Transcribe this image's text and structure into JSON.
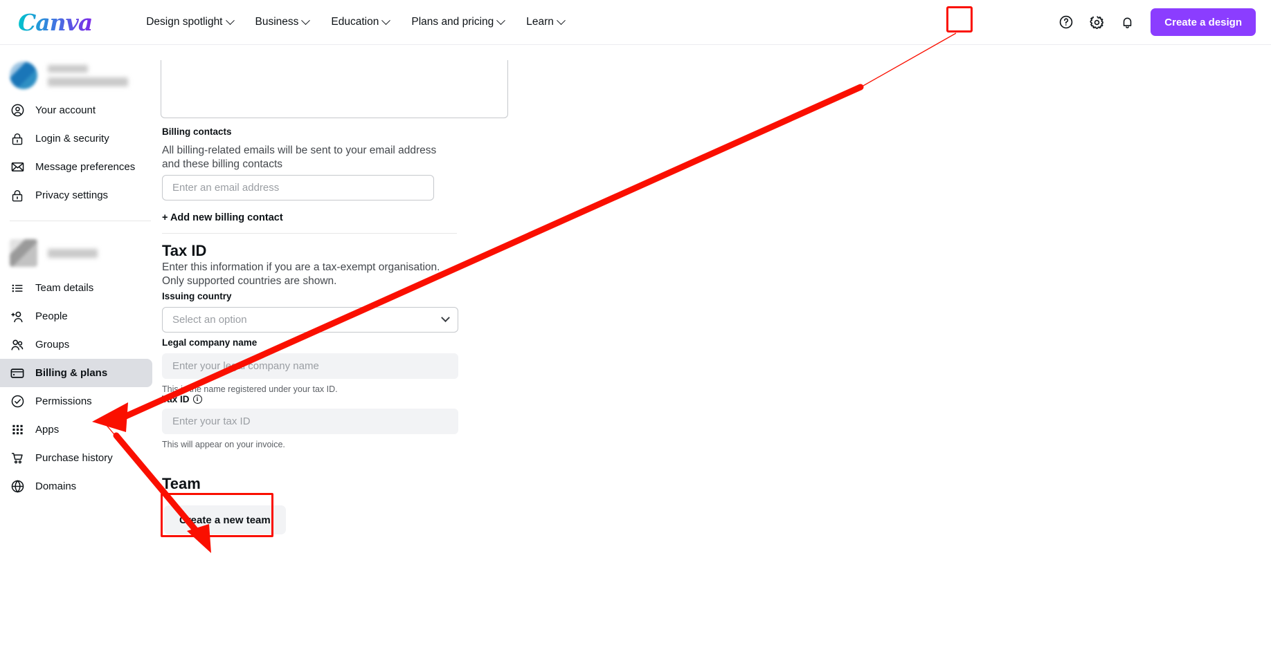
{
  "topnav": {
    "logo": "Canva",
    "items": [
      {
        "label": "Design spotlight",
        "icon": "chevron-down-icon"
      },
      {
        "label": "Business",
        "icon": "chevron-down-icon"
      },
      {
        "label": "Education",
        "icon": "chevron-down-icon"
      },
      {
        "label": "Plans and pricing",
        "icon": "chevron-down-icon"
      },
      {
        "label": "Learn",
        "icon": "chevron-down-icon"
      }
    ],
    "help_icon": "help-circle-icon",
    "settings_icon": "gear-icon",
    "notifications_icon": "bell-icon",
    "create_button": "Create a design",
    "create_button_color": "#8b3dff"
  },
  "sidebar": {
    "user_account_items": [
      {
        "label": "Your account",
        "icon": "user-circle-icon"
      },
      {
        "label": "Login & security",
        "icon": "lock-icon"
      },
      {
        "label": "Message preferences",
        "icon": "envelope-icon"
      },
      {
        "label": "Privacy settings",
        "icon": "lock-icon"
      }
    ],
    "team_items": [
      {
        "label": "Team details",
        "icon": "list-icon"
      },
      {
        "label": "People",
        "icon": "add-person-icon"
      },
      {
        "label": "Groups",
        "icon": "people-icon"
      },
      {
        "label": "Billing & plans",
        "icon": "credit-card-icon",
        "active": true
      },
      {
        "label": "Permissions",
        "icon": "check-circle-icon"
      },
      {
        "label": "Apps",
        "icon": "grid-dots-icon"
      },
      {
        "label": "Purchase history",
        "icon": "shopping-cart-icon"
      },
      {
        "label": "Domains",
        "icon": "globe-icon"
      }
    ],
    "active_item": "Billing & plans",
    "active_bg": "#dcdee3"
  },
  "main": {
    "billing_contacts": {
      "label": "Billing contacts",
      "description": "All billing-related emails will be sent to your email address and these billing contacts",
      "email_placeholder": "Enter an email address",
      "add_link": "+ Add new billing contact"
    },
    "tax_id": {
      "heading": "Tax ID",
      "description": "Enter this information if you are a tax-exempt organisation. Only supported countries are shown.",
      "issuing_country_label": "Issuing country",
      "issuing_country_placeholder": "Select an option",
      "legal_company_label": "Legal company name",
      "legal_company_placeholder": "Enter your legal company name",
      "legal_company_hint": "This is the name registered under your tax ID.",
      "tax_id_label": "Tax ID",
      "tax_id_info_icon": "info-icon",
      "tax_id_placeholder": "Enter your tax ID",
      "tax_id_hint": "This will appear on your invoice."
    },
    "team": {
      "heading": "Team",
      "create_team_button": "Create a new team"
    }
  },
  "annotations": {
    "color": "#fa0f00",
    "highlight_gear": "gear-icon highlighted",
    "highlight_create_team": "Create a new team button highlighted",
    "arrow_to_billing": "arrow pointing to Billing & plans",
    "arrow_to_create_team": "arrow pointing to Create a new team"
  }
}
